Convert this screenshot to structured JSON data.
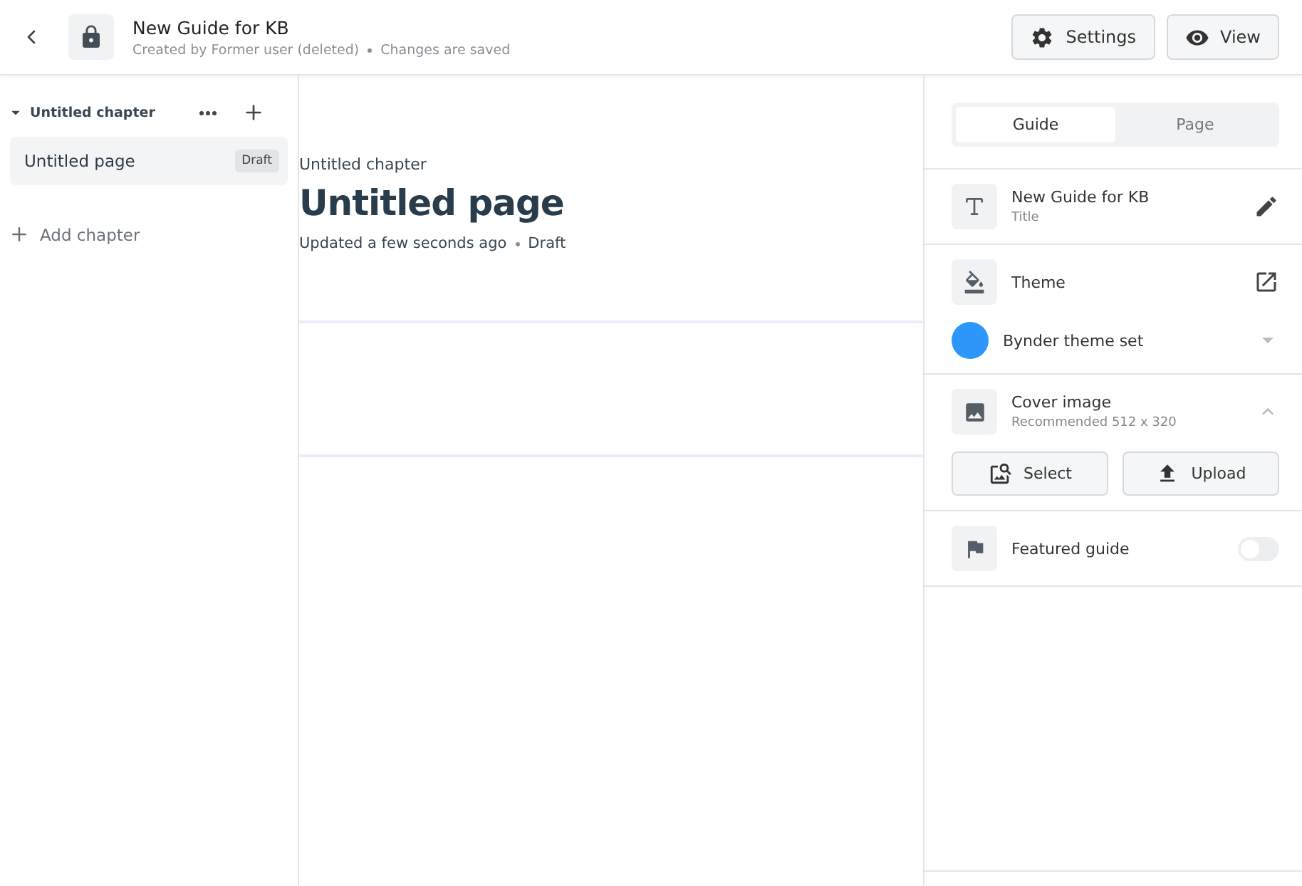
{
  "header": {
    "title": "New Guide for KB",
    "created": "Created by Former user (deleted)",
    "status": "Changes are saved",
    "buttons": [
      {
        "kind": "settings",
        "label": "Settings"
      },
      {
        "kind": "view",
        "label": "View"
      }
    ]
  },
  "sidebar": {
    "chapters": [
      {
        "title": "Untitled chapter",
        "expanded": true,
        "pages": [
          {
            "title": "Untitled page",
            "badge": "Draft",
            "selected": true
          }
        ]
      }
    ],
    "add_chapter": "Add chapter"
  },
  "main": {
    "chapter": "Untitled chapter",
    "title": "Untitled page",
    "updated": "Updated a few seconds ago",
    "status": "Draft"
  },
  "panel": {
    "tabs": [
      {
        "label": "Guide",
        "selected": true
      },
      {
        "label": "Page",
        "selected": false
      }
    ],
    "title_row": {
      "value": "New Guide for KB",
      "label": "Title"
    },
    "theme": {
      "label": "Theme",
      "theme_set": {
        "name": "Bynder theme set",
        "color": "#2d96fb"
      }
    },
    "cover": {
      "label": "Cover image",
      "hint": "Recommended 512 x 320",
      "expanded": true,
      "buttons": [
        {
          "kind": "select",
          "label": "Select"
        },
        {
          "kind": "upload",
          "label": "Upload"
        }
      ]
    },
    "featured": {
      "label": "Featured guide",
      "on": false
    }
  }
}
